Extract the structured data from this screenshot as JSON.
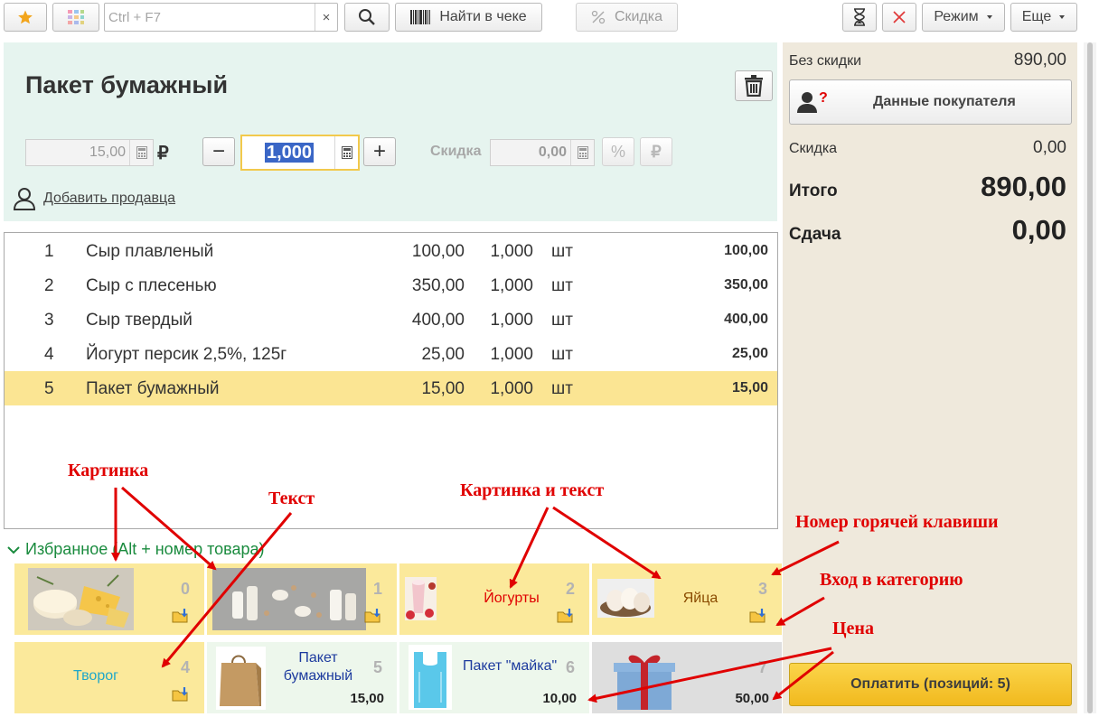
{
  "toolbar": {
    "search_placeholder": "Ctrl + F7",
    "clear_glyph": "×",
    "find_in_receipt": "Найти в чеке",
    "discount": "Скидка",
    "mode": "Режим",
    "more": "Еще"
  },
  "product": {
    "title": "Пакет бумажный",
    "price": "15,00",
    "currency": "₽",
    "minus": "−",
    "quantity": "1,000",
    "plus": "+",
    "discount_label": "Скидка",
    "discount_value": "0,00",
    "percent_glyph": "%",
    "ruble_glyph": "₽",
    "add_seller": "Добавить продавца"
  },
  "items": [
    {
      "num": "1",
      "name": "Сыр плавленый",
      "price": "100,00",
      "qty": "1,000",
      "unit": "шт",
      "sum": "100,00",
      "selected": false
    },
    {
      "num": "2",
      "name": "Сыр с плесенью",
      "price": "350,00",
      "qty": "1,000",
      "unit": "шт",
      "sum": "350,00",
      "selected": false
    },
    {
      "num": "3",
      "name": "Сыр твердый",
      "price": "400,00",
      "qty": "1,000",
      "unit": "шт",
      "sum": "400,00",
      "selected": false
    },
    {
      "num": "4",
      "name": "Йогурт персик 2,5%, 125г",
      "price": "25,00",
      "qty": "1,000",
      "unit": "шт",
      "sum": "25,00",
      "selected": false
    },
    {
      "num": "5",
      "name": "Пакет бумажный",
      "price": "15,00",
      "qty": "1,000",
      "unit": "шт",
      "sum": "15,00",
      "selected": true
    }
  ],
  "favorites": {
    "header": "Избранное (Alt + номер товара)",
    "tiles": [
      {
        "key": "0",
        "label": "",
        "price": ""
      },
      {
        "key": "1",
        "label": "",
        "price": ""
      },
      {
        "key": "2",
        "label": "Йогурты",
        "price": ""
      },
      {
        "key": "3",
        "label": "Яйца",
        "price": ""
      },
      {
        "key": "4",
        "label": "Творог",
        "price": ""
      },
      {
        "key": "5",
        "label": "Пакет бумажный",
        "price": "15,00"
      },
      {
        "key": "6",
        "label": "Пакет \"майка\"",
        "price": "10,00"
      },
      {
        "key": "7",
        "label": "",
        "price": "50,00"
      }
    ]
  },
  "summary": {
    "no_discount_label": "Без скидки",
    "no_discount_value": "890,00",
    "customer_button": "Данные покупателя",
    "discount_label": "Скидка",
    "discount_value": "0,00",
    "total_label": "Итого",
    "total_value": "890,00",
    "change_label": "Сдача",
    "change_value": "0,00",
    "pay_button": "Оплатить (позиций: 5)"
  },
  "annotations": {
    "picture": "Картинка",
    "text": "Текст",
    "picture_and_text": "Картинка и текст",
    "hotkey_number": "Номер горячей клавиши",
    "enter_category": "Вход в категорию",
    "price": "Цена"
  },
  "colors": {
    "accent_yellow": "#fbe99b",
    "selected_row": "#fbe593",
    "product_panel": "#e6f4ef",
    "summary_panel": "#efe9dc",
    "annotation": "#e00000",
    "favorites_header": "#1a8b3e"
  }
}
